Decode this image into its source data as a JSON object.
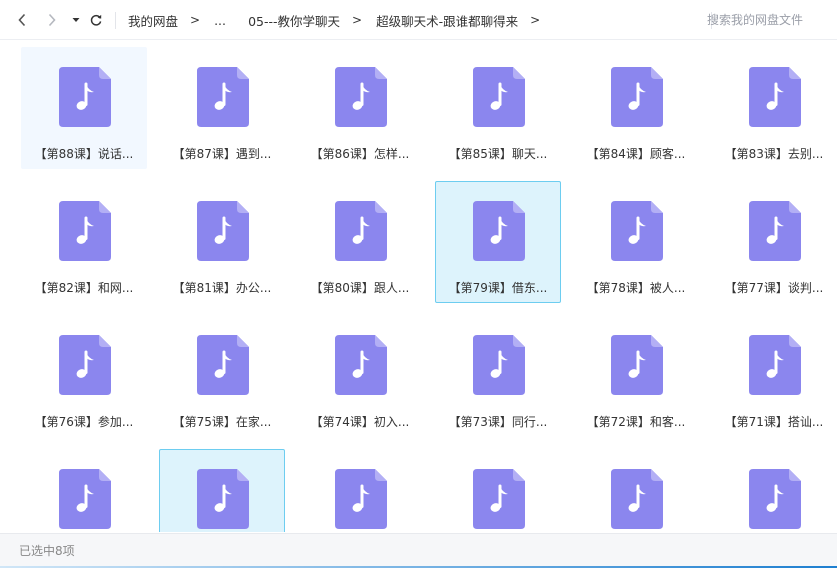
{
  "nav": {
    "back_icon": "chevron-left-icon",
    "forward_icon": "chevron-right-icon",
    "dropdown_icon": "caret-down-icon",
    "refresh_icon": "refresh-icon"
  },
  "breadcrumb": {
    "items": [
      "我的网盘",
      "...",
      "05---教你学聊天",
      "超级聊天术-跟谁都聊得来"
    ],
    "separator": ">"
  },
  "search": {
    "placeholder": "搜索我的网盘文件"
  },
  "colors": {
    "icon_fill": "#8b86ee",
    "selected_bg": "#ddf3fc",
    "selected_border": "#6dcdf0",
    "hover_bg": "#f2f8ff"
  },
  "files": [
    {
      "label": "【第88课】说话...",
      "state": "hover"
    },
    {
      "label": "【第87课】遇到...",
      "state": ""
    },
    {
      "label": "【第86课】怎样...",
      "state": ""
    },
    {
      "label": "【第85课】聊天...",
      "state": ""
    },
    {
      "label": "【第84课】顾客...",
      "state": ""
    },
    {
      "label": "【第83课】去别...",
      "state": ""
    },
    {
      "label": "【第82课】和网...",
      "state": ""
    },
    {
      "label": "【第81课】办公...",
      "state": ""
    },
    {
      "label": "【第80课】跟人...",
      "state": ""
    },
    {
      "label": "【第79课】借东...",
      "state": "selected"
    },
    {
      "label": "【第78课】被人...",
      "state": ""
    },
    {
      "label": "【第77课】谈判...",
      "state": ""
    },
    {
      "label": "【第76课】参加...",
      "state": ""
    },
    {
      "label": "【第75课】在家...",
      "state": ""
    },
    {
      "label": "【第74课】初入...",
      "state": ""
    },
    {
      "label": "【第73课】同行...",
      "state": ""
    },
    {
      "label": "【第72课】和客...",
      "state": ""
    },
    {
      "label": "【第71课】搭讪...",
      "state": ""
    },
    {
      "label": "",
      "state": ""
    },
    {
      "label": "",
      "state": "selected"
    },
    {
      "label": "",
      "state": ""
    },
    {
      "label": "",
      "state": ""
    },
    {
      "label": "",
      "state": ""
    },
    {
      "label": "",
      "state": ""
    }
  ],
  "file_icon_name": "music-file-icon",
  "footer": {
    "status": "已选中8项"
  }
}
